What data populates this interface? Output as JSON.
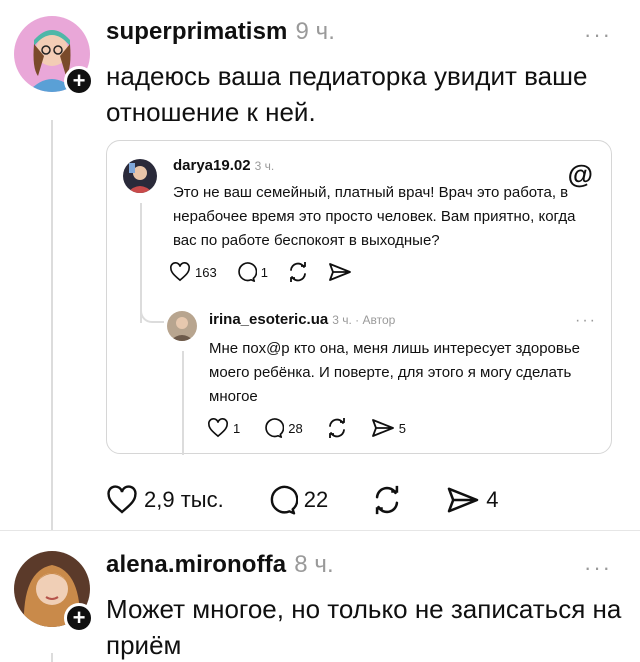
{
  "post1": {
    "username": "superprimatism",
    "time": "9 ч.",
    "more": "···",
    "text": "надеюсь ваша педиаторка увидит ваше отношение к ней.",
    "actions": {
      "likes": "2,9 тыс.",
      "comments": "22",
      "shares": "4"
    }
  },
  "quote": {
    "user1": {
      "username": "darya19.02",
      "time": "3 ч.",
      "text": "Это не ваш семейный, платный врач! Врач это работа, в нерабочее время это просто человек. Вам приятно, когда вас по работе беспокоят в выходные?",
      "likes": "163",
      "comments": "1"
    },
    "user2": {
      "username": "irina_esoteric.ua",
      "time": "3 ч. · Автор",
      "more": "···",
      "text": "Мне пох@р кто она, меня лишь интересует здоровье моего ребёнка. И поверте, для  этого я могу сделать многое",
      "likes": "1",
      "comments": "28",
      "shares": "5"
    }
  },
  "post2": {
    "username": "alena.mironoffa",
    "time": "8 ч.",
    "more": "···",
    "text": "Может многое, но только не записаться на приём"
  }
}
